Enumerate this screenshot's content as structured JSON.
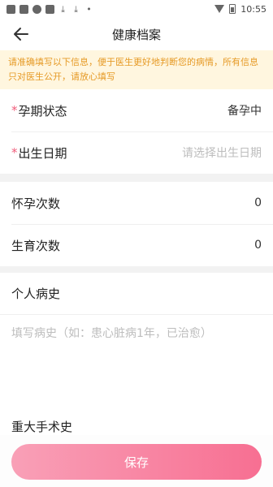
{
  "status_bar": {
    "time": "10:55",
    "icons": [
      "app-icon",
      "app-icon",
      "chat-icon",
      "app-icon",
      "download-icon",
      "download-icon",
      "dot-icon",
      "wifi-icon",
      "battery-icon"
    ]
  },
  "header": {
    "title": "健康档案",
    "back_icon": "arrow-left-icon"
  },
  "notice": {
    "text": "请准确填写以下信息，便于医生更好地判断您的病情，所有信息只对医生公开，请放心填写"
  },
  "basic": {
    "pregnancy_status": {
      "required_mark": "*",
      "label": "孕期状态",
      "value": "备孕中"
    },
    "birth_date": {
      "required_mark": "*",
      "label": "出生日期",
      "placeholder": "请选择出生日期"
    }
  },
  "counts": {
    "pregnancies": {
      "label": "怀孕次数",
      "value": "0"
    },
    "births": {
      "label": "生育次数",
      "value": "0"
    }
  },
  "history": {
    "title": "个人病史",
    "placeholder": "填写病史（如：患心脏病1年，已治愈）"
  },
  "surgery": {
    "title": "重大手术史"
  },
  "footer": {
    "save_label": "保存"
  },
  "colors": {
    "accent_pink": "#f76f92",
    "notice_bg": "#fff6df",
    "notice_text": "#e69a26"
  }
}
